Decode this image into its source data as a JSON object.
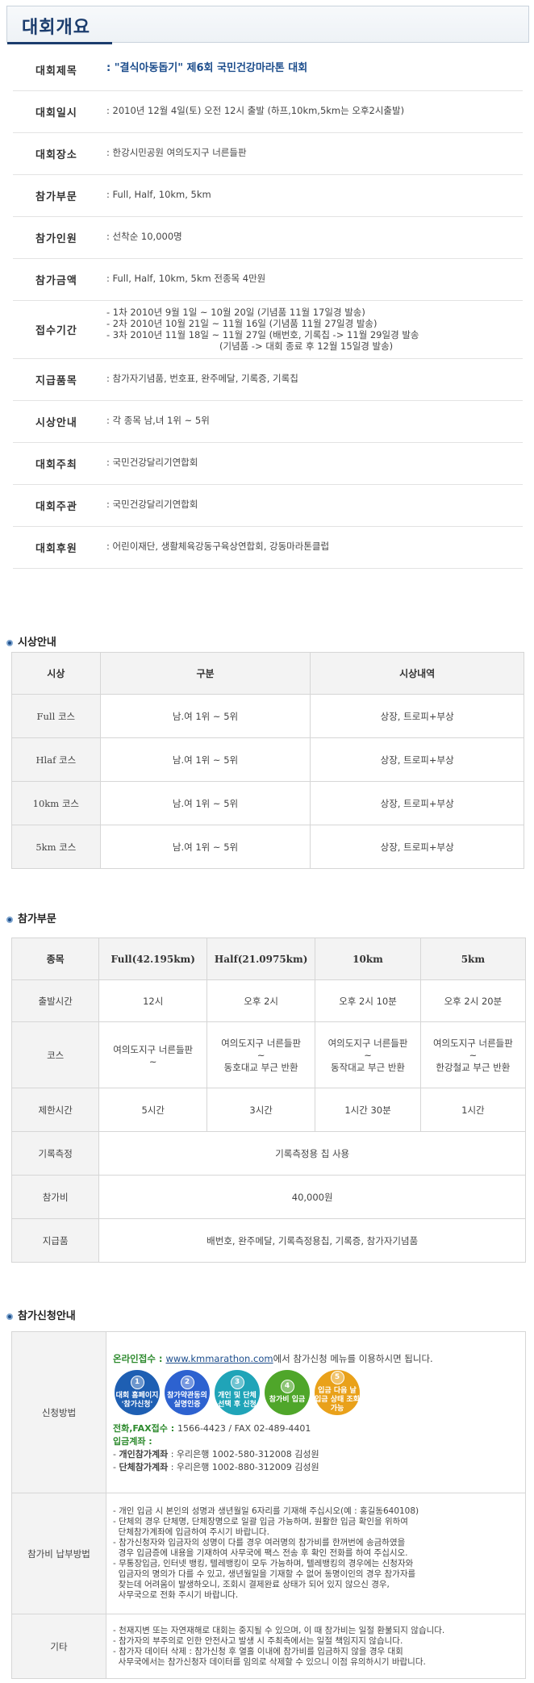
{
  "page_title": "대회개요",
  "overview": [
    {
      "label": "대회제목",
      "value": ": \"결식아동돕기\" 제6회 국민건강마라톤 대회",
      "highlight": true
    },
    {
      "label": "대회일시",
      "value": ": 2010년 12월 4일(토) 오전 12시 출발 (하프,10km,5km는 오후2시출발)"
    },
    {
      "label": "대회장소",
      "value": ": 한강시민공원 여의도지구 너른들판"
    },
    {
      "label": "참가부문",
      "value": ": Full, Half, 10km, 5km"
    },
    {
      "label": "참가인원",
      "value": ": 선착순 10,000명"
    },
    {
      "label": "참가금액",
      "value": ": Full, Half, 10km, 5km 전종목 4만원"
    },
    {
      "label": "접수기간",
      "lines": [
        "- 1차 2010년 9월 1일 ~ 10월 20일 (기념품 11월 17일경 발송)",
        "- 2차 2010년 10월 21일 ~ 11월 16일 (기념품 11월 27일경 발송)",
        "- 3차 2010년 11월 18일 ~ 11월 27일 (배번호, 기록칩 -> 11월 29일경 발송",
        "(기념품 -> 대회 종료 후 12월 15일경 발송)"
      ]
    },
    {
      "label": "지급품목",
      "value": ": 참가자기념품, 번호표, 완주메달, 기록증, 기록칩"
    },
    {
      "label": "시상안내",
      "value": ": 각 종목 남,녀 1위 ~ 5위"
    },
    {
      "label": "대회주최",
      "value": ": 국민건강달리기연합회"
    },
    {
      "label": "대회주관",
      "value": ": 국민건강달리기연합회"
    },
    {
      "label": "대회후원",
      "value": ": 어린이재단, 생활체육강동구육상연합회, 강동마라톤클럽"
    }
  ],
  "awards": {
    "title": "시상안내",
    "headers": [
      "시상",
      "구분",
      "시상내역"
    ],
    "rows": [
      [
        "Full 코스",
        "남.여 1위 ~ 5위",
        "상장, 트로피+부상"
      ],
      [
        "Hlaf 코스",
        "남.여 1위 ~ 5위",
        "상장, 트로피+부상"
      ],
      [
        "10km 코스",
        "남.여 1위 ~ 5위",
        "상장, 트로피+부상"
      ],
      [
        "5km 코스",
        "남.여 1위 ~ 5위",
        "상장, 트로피+부상"
      ]
    ]
  },
  "categories": {
    "title": "참가부문",
    "headers": [
      "종목",
      "Full(42.195km)",
      "Half(21.0975km)",
      "10km",
      "5km"
    ],
    "start_label": "출발시간",
    "start": [
      "12시",
      "오후 2시",
      "오후 2시 10분",
      "오후 2시 20분"
    ],
    "course_label": "코스",
    "course": [
      {
        "l1": "여의도지구 너른들판",
        "l2": "~",
        "l3": ""
      },
      {
        "l1": "여의도지구 너른들판",
        "l2": "~",
        "l3": "동호대교 부근 반환"
      },
      {
        "l1": "여의도지구 너른들판",
        "l2": "~",
        "l3": "동작대교 부근 반환"
      },
      {
        "l1": "여의도지구 너른들판",
        "l2": "~",
        "l3": "한강철교 부근 반환"
      }
    ],
    "limit_label": "제한시간",
    "limit": [
      "5시간",
      "3시간",
      "1시간 30분",
      "1시간"
    ],
    "record_label": "기록측정",
    "record": "기록측정용 칩 사용",
    "fee_label": "참가비",
    "fee": "40,000원",
    "items_label": "지급품",
    "items": "배번호, 완주메달, 기록측정용칩, 기록증, 참가자기념품"
  },
  "application": {
    "title": "참가신청안내",
    "method_label": "신청방법",
    "online_prefix": "온라인접수 : ",
    "online_link": "www.kmmarathon.com",
    "online_suffix": "에서 참가신청 메뉴를 이용하시면 됩니다.",
    "steps": [
      {
        "num": "1",
        "text1": "대회 홈페이지",
        "text2": "'참가신청'",
        "color": "#1e5fb3"
      },
      {
        "num": "2",
        "text1": "참가약관동의",
        "text2": "실명인증",
        "color": "#2d62d0"
      },
      {
        "num": "3",
        "text1": "개인 및 단체",
        "text2": "선택 후 신청",
        "color": "#20a4b8"
      },
      {
        "num": "4",
        "text1": "참가비 입금",
        "text2": "",
        "color": "#4fa62a"
      },
      {
        "num": "5",
        "text1": "입금 다음 날",
        "text2": "입금 상태 조회 가능",
        "color": "#e9a11a"
      }
    ],
    "phone_label": "전화,FAX접수 : ",
    "phone_value": "1566-4423 / FAX 02-489-4401",
    "account_label": "입금계좌 :",
    "personal_label": "개인참가계좌",
    "personal_value": ": 우리은행 1002-580-312008 김성원",
    "group_label": "단체참가계좌",
    "group_value": ": 우리은행 1002-880-312009 김성원",
    "payment_label": "참가비 납부방법",
    "payment_lines": [
      "- 개인 입금 시 본인의 성명과 생년월일 6자리를 기재해 주십시오(예 : 홍길동640108)",
      "- 단체의 경우 단체명, 단체장명으로 일괄 입금 가능하며, 원활한 입금 확인을 위하여",
      "  단체참가계좌에 입금하여 주시기 바랍니다.",
      "- 참가신청자와 입금자의 성명이 다를 경우 여러명의 참가비를 한꺼번에 송금하였을",
      "  경우 입금증에 내용을 기재하여 사무국에 팩스 전송 후 확인 전화를 하여 주십시오.",
      "- 무통장입금, 인터넷 뱅킹, 텔레뱅킹이 모두 가능하며, 텔레뱅킹의 경우에는 신청자와",
      "  입금자의 명의가 다를 수 있고, 생년월일을 기재할 수 없어 동명이인의 경우 참가자를",
      "  찾는데 어려움이 발생하오니, 조회시 결제완료 상태가 되어 있지 않으신 경우,",
      "  사무국으로 전화 주시기 바랍니다."
    ],
    "other_label": "기타",
    "other_lines": [
      "- 천재지변 또는 자연재해로 대회는 중지될 수 있으며, 이 때 참가비는 일절 환불되지 않습니다.",
      "- 참가자의 부주의로 인한 안전사고 발생 시 주최측에서는 일절 책임지지 않습니다.",
      "- 참가자 데이터 삭제 : 참가신청 후 열흘 이내에 참가비를 입금하지 않을 경우 대회",
      "  사무국에서는 참가신청자 데이터를 임의로 삭제할 수 있으니 이점 유의하시기 바랍니다."
    ]
  }
}
